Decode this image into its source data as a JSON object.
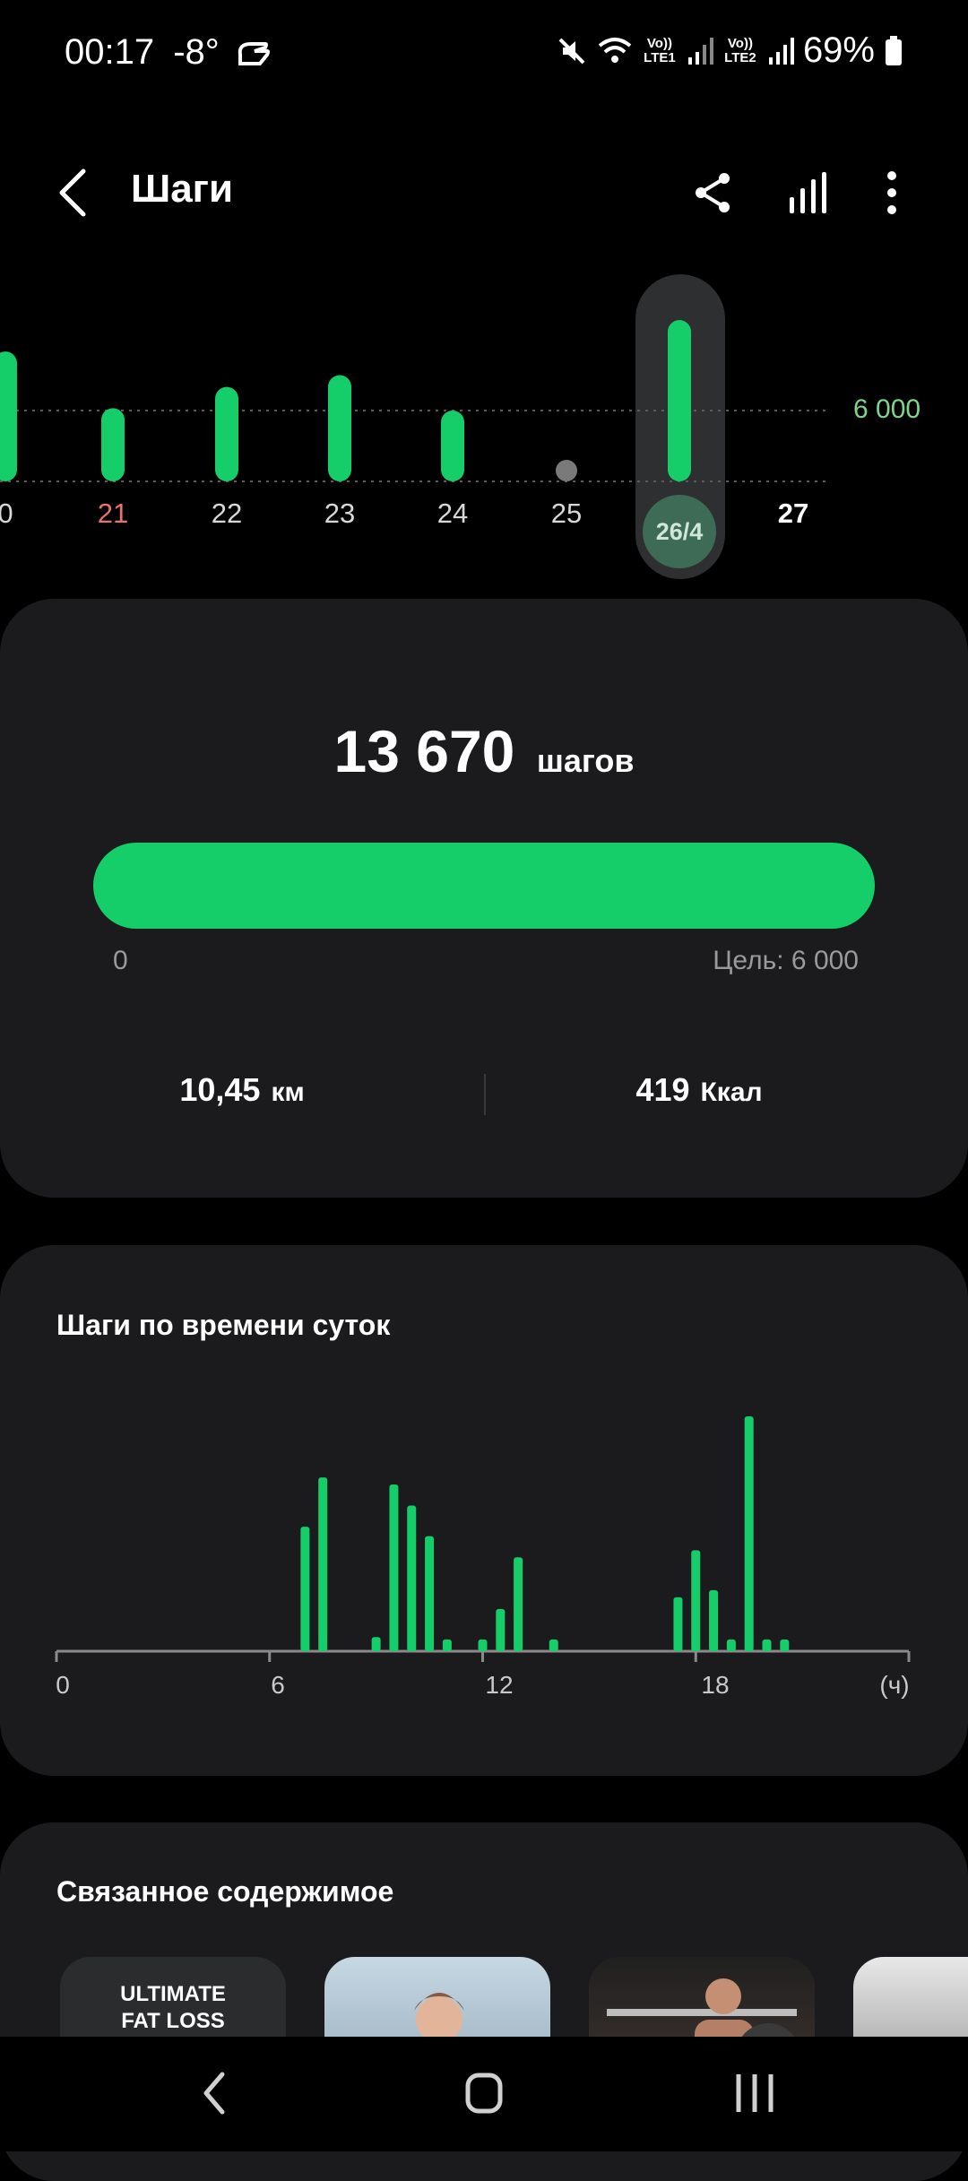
{
  "status_bar": {
    "time": "00:17",
    "temperature": "-8°",
    "sim1_label": "Vo)) LTE1",
    "sim2_label": "Vo)) LTE2",
    "battery": "69%"
  },
  "app_bar": {
    "title": "Шаги",
    "icons": [
      "back-arrow-icon",
      "share-icon",
      "bar-chart-icon",
      "more-vert-icon"
    ]
  },
  "week": {
    "goal_label": "6 000",
    "goal": 6000,
    "days": [
      {
        "label": "0",
        "steps": 11000
      },
      {
        "label": "21",
        "steps": 6200,
        "color": "#e8736c"
      },
      {
        "label": "22",
        "steps": 8000
      },
      {
        "label": "23",
        "steps": 9000
      },
      {
        "label": "24",
        "steps": 6000
      },
      {
        "label": "25",
        "steps": 0
      },
      {
        "label": "26/4",
        "steps": 13670,
        "selected": true
      },
      {
        "label": "27",
        "steps": null,
        "bold": true
      }
    ]
  },
  "summary": {
    "steps_value": "13 670",
    "steps_unit": "шагов",
    "progress": 1.0,
    "progress_min": "0",
    "progress_goal": "Цель: 6 000",
    "distance_value": "10,45",
    "distance_unit": "км",
    "calories_value": "419",
    "calories_unit": "Ккал"
  },
  "hourly": {
    "title": "Шаги по времени суток",
    "ticks": [
      "0",
      "6",
      "12",
      "18",
      "(ч)"
    ],
    "bars": [
      {
        "h": 7.0,
        "v": 0.53
      },
      {
        "h": 7.5,
        "v": 0.74
      },
      {
        "h": 9.0,
        "v": 0.06
      },
      {
        "h": 9.5,
        "v": 0.71
      },
      {
        "h": 10.0,
        "v": 0.62
      },
      {
        "h": 10.5,
        "v": 0.49
      },
      {
        "h": 11.0,
        "v": 0.05
      },
      {
        "h": 12.0,
        "v": 0.05
      },
      {
        "h": 12.5,
        "v": 0.18
      },
      {
        "h": 13.0,
        "v": 0.4
      },
      {
        "h": 14.0,
        "v": 0.05
      },
      {
        "h": 17.5,
        "v": 0.23
      },
      {
        "h": 18.0,
        "v": 0.43
      },
      {
        "h": 18.5,
        "v": 0.26
      },
      {
        "h": 19.0,
        "v": 0.05
      },
      {
        "h": 19.5,
        "v": 1.0
      },
      {
        "h": 20.0,
        "v": 0.05
      },
      {
        "h": 20.5,
        "v": 0.05
      }
    ]
  },
  "related": {
    "title": "Связанное содержимое",
    "items": [
      {
        "line1": "ULTIMATE",
        "line2": "FAT LOSS"
      },
      {
        "label": "woman-workout-thumb"
      },
      {
        "label": "man-gym-thumb"
      },
      {
        "label": "partial-thumb"
      }
    ]
  },
  "colors": {
    "accent": "#15ce6a",
    "card": "#1b1b1d",
    "selected_pill": "#2e2f30",
    "selected_circle": "#3e6b55"
  },
  "nav": {
    "icons": [
      "nav-back-icon",
      "nav-home-icon",
      "nav-recents-icon"
    ]
  }
}
